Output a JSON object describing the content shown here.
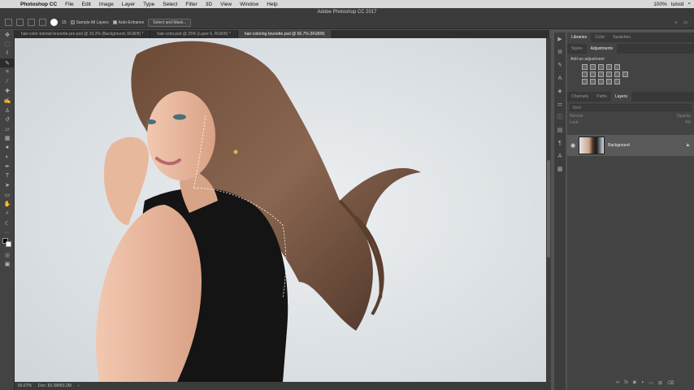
{
  "menubar": {
    "app": "Photoshop CC",
    "items": [
      "File",
      "Edit",
      "Image",
      "Layer",
      "Type",
      "Select",
      "Filter",
      "3D",
      "View",
      "Window",
      "Help"
    ],
    "battery": "100%",
    "user": "tutvid"
  },
  "window_title": "Adobe Photoshop CC 2017",
  "options": {
    "sample_all_layers": "Sample All Layers",
    "auto_enhance": "Auto-Enhance",
    "select_and_mask": "Select and Mask...",
    "brush_size": "15"
  },
  "tabs": [
    {
      "label": "hair-color-tutorial-brunette-pre.psd @ 33.3% (Background, RGB/8) *"
    },
    {
      "label": "hair-color.psd @ 25% (Layer 6, RGB/8) *"
    },
    {
      "label": "hair-coloring-brunette.psd @ 66.7% (RGB/8)"
    }
  ],
  "status": {
    "zoom": "66.67%",
    "doc": "Doc: 83.3M/83.2M"
  },
  "panels": {
    "top_tabs": [
      "Libraries",
      "Color",
      "Swatches"
    ],
    "adj_tabs": [
      "Styles",
      "Adjustments"
    ],
    "add_adjustment": "Add an adjustment",
    "layer_tabs": [
      "Channels",
      "Paths",
      "Layers"
    ],
    "kind": "Kind",
    "blend": "Normal",
    "opacity": "Opacity:",
    "lock": "Lock:",
    "fill": "Fill:",
    "layer_name": "Background"
  },
  "colors": {
    "accent": "#6a9fd8"
  }
}
